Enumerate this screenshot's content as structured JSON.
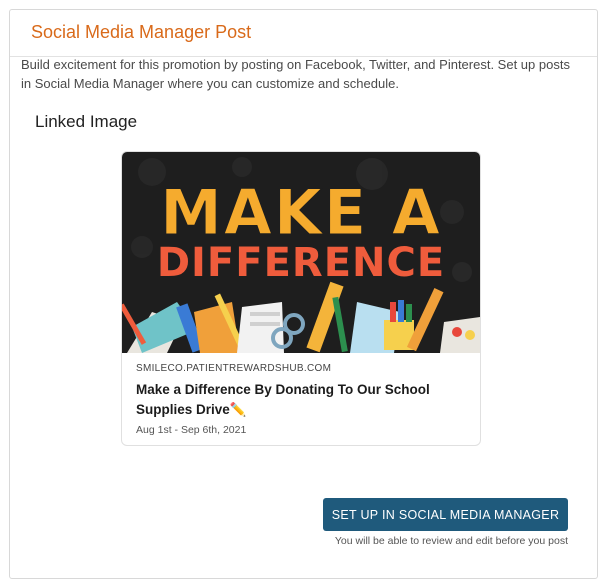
{
  "panel": {
    "title": "Social Media Manager Post",
    "description": "Build excitement for this promotion by posting on Facebook, Twitter, and Pinterest. Set up posts in Social Media Manager where you can customize and schedule."
  },
  "linked_image": {
    "section_title": "Linked Image",
    "image_text_line1": "MAKE A",
    "image_text_line2": "DIFFERENCE",
    "domain": "SMILECO.PATIENTREWARDSHUB.COM",
    "title": "Make a Difference By Donating To Our School Supplies Drive✏️",
    "date": "Aug 1st - Sep 6th, 2021"
  },
  "cta": {
    "button_label": "SET UP IN SOCIAL MEDIA MANAGER",
    "note": "You will be able to review and edit before you post"
  },
  "colors": {
    "title_orange": "#d96a1a",
    "button_blue": "#1f5a7c",
    "image_bg": "#1e1e1e"
  }
}
